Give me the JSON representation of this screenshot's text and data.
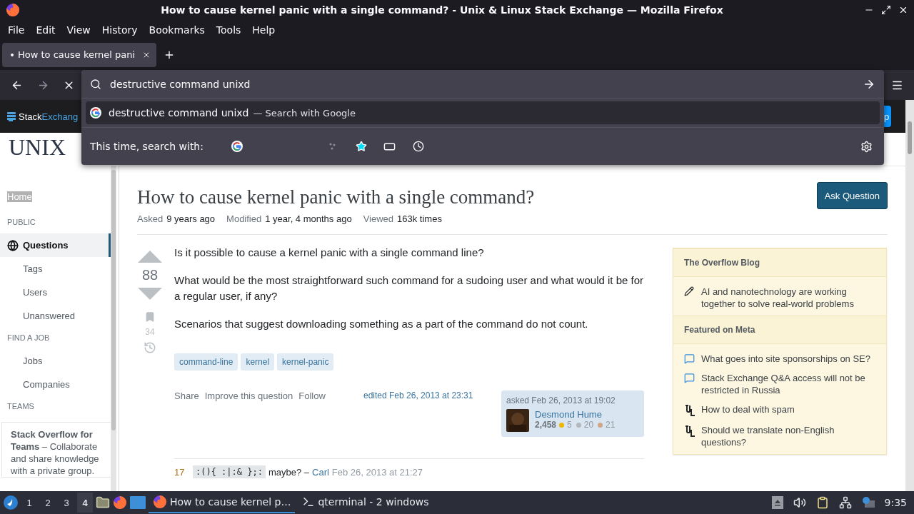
{
  "window": {
    "title": "How to cause kernel panic with a single command? - Unix & Linux Stack Exchange — Mozilla Firefox"
  },
  "menu": [
    "File",
    "Edit",
    "View",
    "History",
    "Bookmarks",
    "Tools",
    "Help"
  ],
  "tabs": [
    {
      "label": "How to cause kernel pani",
      "selected": true
    }
  ],
  "nav": {
    "forward_disabled": true
  },
  "address_bar": {
    "value": "destructive command unixd",
    "suggestions": [
      {
        "text": "destructive command unixd",
        "action": "— Search with Google",
        "selected": true
      }
    ],
    "search_with_label": "This time, search with:"
  },
  "site_header": {
    "brand_left": "Stack",
    "brand_right": "Exchang",
    "signup_fragment": "p",
    "site_logo": "UNIX"
  },
  "sidebar": {
    "home": "Home",
    "sections": [
      {
        "heading": "PUBLIC",
        "items": [
          {
            "label": "Questions",
            "selected": true
          },
          {
            "label": "Tags",
            "selected": false
          },
          {
            "label": "Users",
            "selected": false
          },
          {
            "label": "Unanswered",
            "selected": false
          }
        ]
      },
      {
        "heading": "FIND A JOB",
        "items": [
          {
            "label": "Jobs",
            "selected": false
          },
          {
            "label": "Companies",
            "selected": false
          }
        ]
      }
    ],
    "teams_heading": "TEAMS",
    "teams_promo": "**Stack Overflow for Teams** – Collaborate and share knowledge with a private group."
  },
  "question": {
    "title": "How to cause kernel panic with a single command?",
    "ask_button": "Ask Question",
    "meta": [
      {
        "label": "Asked",
        "value": "9 years ago"
      },
      {
        "label": "Modified",
        "value": "1 year, 4 months ago"
      },
      {
        "label": "Viewed",
        "value": "163k times"
      }
    ],
    "votes": "88",
    "bookmarks": "34",
    "paragraphs": [
      "Is it possible to cause a kernel panic with a single command line?",
      "What would be the most straightforward such command for a sudoing user and what would it be for a regular user, if any?",
      "Scenarios that suggest downloading something as a part of the command do not count."
    ],
    "tags": [
      "command-line",
      "kernel",
      "kernel-panic"
    ],
    "actions": [
      "Share",
      "Improve this question",
      "Follow"
    ],
    "edited": "edited Feb 26, 2013 at 23:31",
    "asked": "asked Feb 26, 2013 at 19:02",
    "user": {
      "name": "Desmond Hume",
      "reputation": "2,458",
      "badges": [
        {
          "count": "5",
          "color": "#f1b600"
        },
        {
          "count": "20",
          "color": "#b4b8bc"
        },
        {
          "count": "21",
          "color": "#d1a684"
        }
      ]
    },
    "comments": [
      {
        "score": "17",
        "code": ":(){ :|:& };:",
        "text": "maybe? –",
        "author": "Carl",
        "date": "Feb 26, 2013 at 21:27"
      }
    ]
  },
  "widget": {
    "sections": [
      {
        "heading": "The Overflow Blog",
        "items": [
          {
            "kind": "blog",
            "text": "AI and nanotechnology are working together to solve real-world problems"
          }
        ]
      },
      {
        "heading": "Featured on Meta",
        "items": [
          {
            "kind": "meta",
            "text": "What goes into site sponsorships on SE?"
          },
          {
            "kind": "meta",
            "text": "Stack Exchange Q&A access will not be restricted in Russia"
          },
          {
            "kind": "site",
            "text": "How to deal with spam"
          },
          {
            "kind": "site",
            "text": "Should we translate non-English questions?"
          }
        ]
      }
    ]
  },
  "taskbar": {
    "workspaces": [
      {
        "label": "1",
        "selected": false
      },
      {
        "label": "2",
        "selected": false
      },
      {
        "label": "3",
        "selected": false
      },
      {
        "label": "4",
        "selected": true
      }
    ],
    "tasks": [
      {
        "kind": "firefox",
        "label": "How to cause kernel p…",
        "selected": true
      },
      {
        "kind": "terminal",
        "label": "qterminal - 2 windows",
        "selected": false
      }
    ],
    "clock": "9:35"
  }
}
